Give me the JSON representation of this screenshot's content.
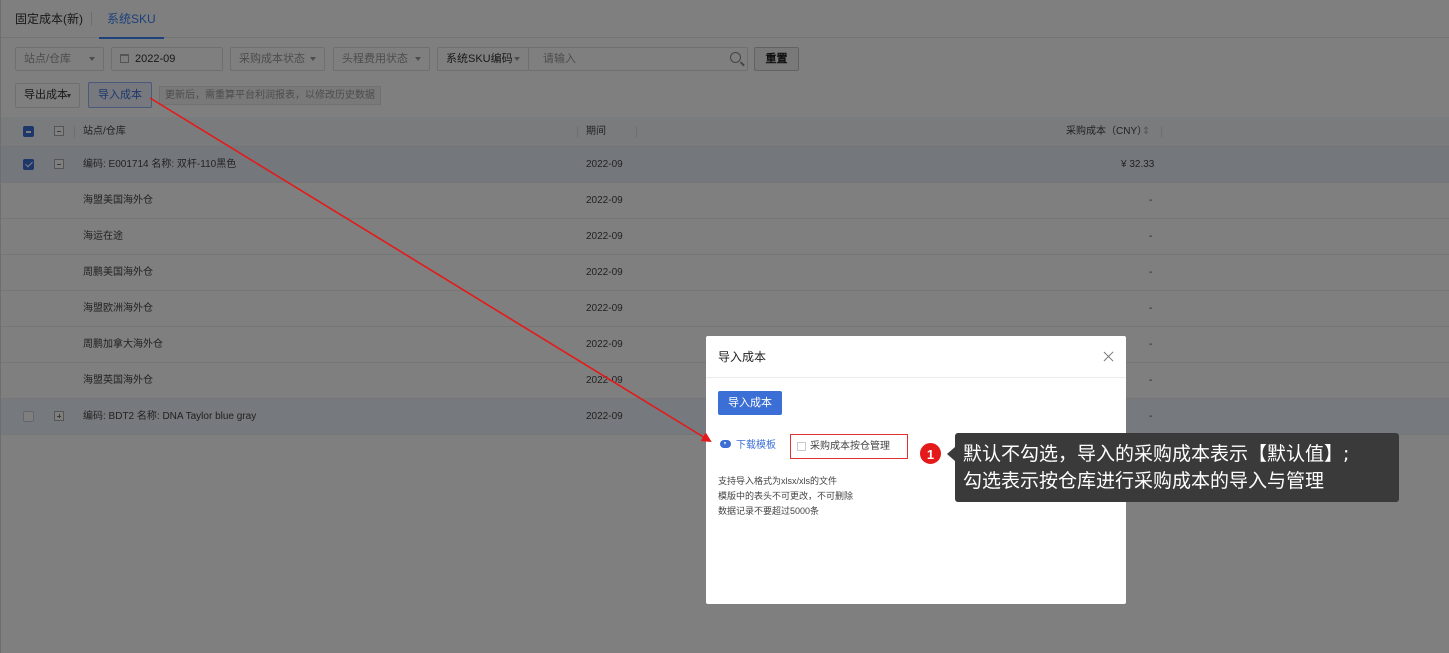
{
  "tabs": [
    {
      "label": "固定成本(新)"
    },
    {
      "label": "系统SKU"
    }
  ],
  "filters": {
    "site_placeholder": "站点/仓库",
    "date_value": "2022-09",
    "purchase_status_placeholder": "采购成本状态",
    "first_leg_status_placeholder": "头程费用状态",
    "sku_type_value": "系统SKU编码",
    "search_placeholder": "请输入",
    "reset_label": "重置"
  },
  "actions": {
    "export_label": "导出成本",
    "import_label": "导入成本",
    "hint": "更新后，需重算平台利润报表，以修改历史数据"
  },
  "table": {
    "headers": {
      "site": "站点/仓库",
      "period": "期间",
      "cost": "采购成本（CNY）"
    },
    "rows": [
      {
        "name": "编码: E001714 名称: 双杆-110黑色",
        "period": "2022-09",
        "cost": "¥ 32.33"
      },
      {
        "name": "海盟美国海外仓",
        "period": "2022-09",
        "cost": "-"
      },
      {
        "name": "海运在途",
        "period": "2022-09",
        "cost": "-"
      },
      {
        "name": "周鹏美国海外仓",
        "period": "2022-09",
        "cost": "-"
      },
      {
        "name": "海盟欧洲海外仓",
        "period": "2022-09",
        "cost": "-"
      },
      {
        "name": "周鹏加拿大海外仓",
        "period": "2022-09",
        "cost": "-"
      },
      {
        "name": "海盟英国海外仓",
        "period": "2022-09",
        "cost": "-"
      },
      {
        "name": "编码: BDT2 名称: DNA Taylor blue gray",
        "period": "2022-09",
        "cost": "-"
      }
    ]
  },
  "modal": {
    "title": "导入成本",
    "import_button": "导入成本",
    "download_label": "下载模板",
    "checkbox_label": "采购成本按仓管理",
    "notes": [
      "支持导入格式为xlsx/xls的文件",
      "模版中的表头不可更改，不可删除",
      "数据记录不要超过5000条"
    ]
  },
  "annotation": {
    "badge": "1",
    "line1": "默认不勾选，导入的采购成本表示【默认值】;",
    "line2": "勾选表示按仓库进行采购成本的导入与管理"
  },
  "colors": {
    "primary": "#3b6fd6",
    "annotation_red": "#e41a1a"
  }
}
